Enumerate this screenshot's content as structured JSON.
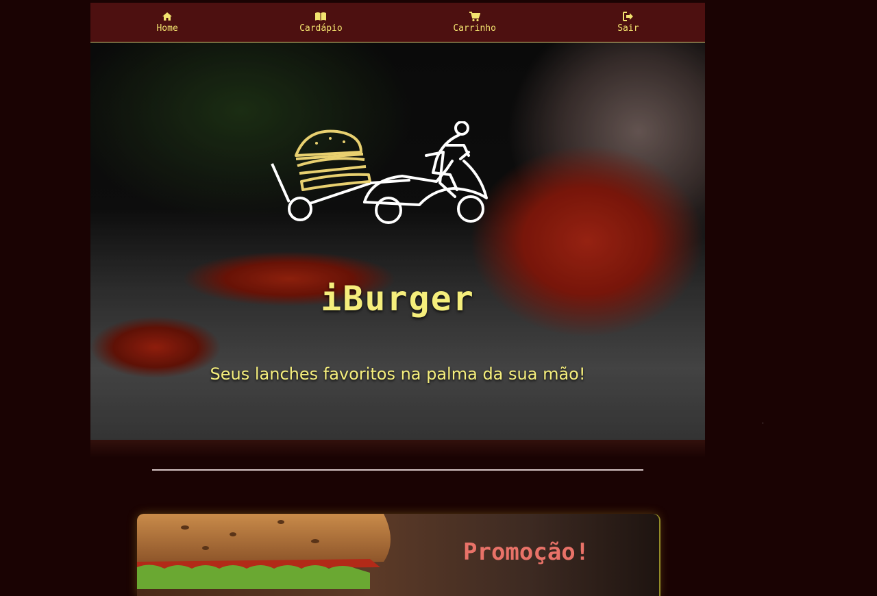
{
  "nav": {
    "items": [
      {
        "label": "Home",
        "icon": "home-icon"
      },
      {
        "label": "Cardápio",
        "icon": "book-icon"
      },
      {
        "label": "Carrinho",
        "icon": "cart-icon"
      },
      {
        "label": "Sair",
        "icon": "sign-out-icon"
      }
    ]
  },
  "hero": {
    "title": "iBurger",
    "subtitle": "Seus lanches favoritos na palma da sua mão!"
  },
  "promo": {
    "title": "Promoção!"
  },
  "colors": {
    "background": "#1a0303",
    "navbar": "#4d1010",
    "accent_yellow": "#f5ee7c",
    "promo_title": "#e87268"
  }
}
